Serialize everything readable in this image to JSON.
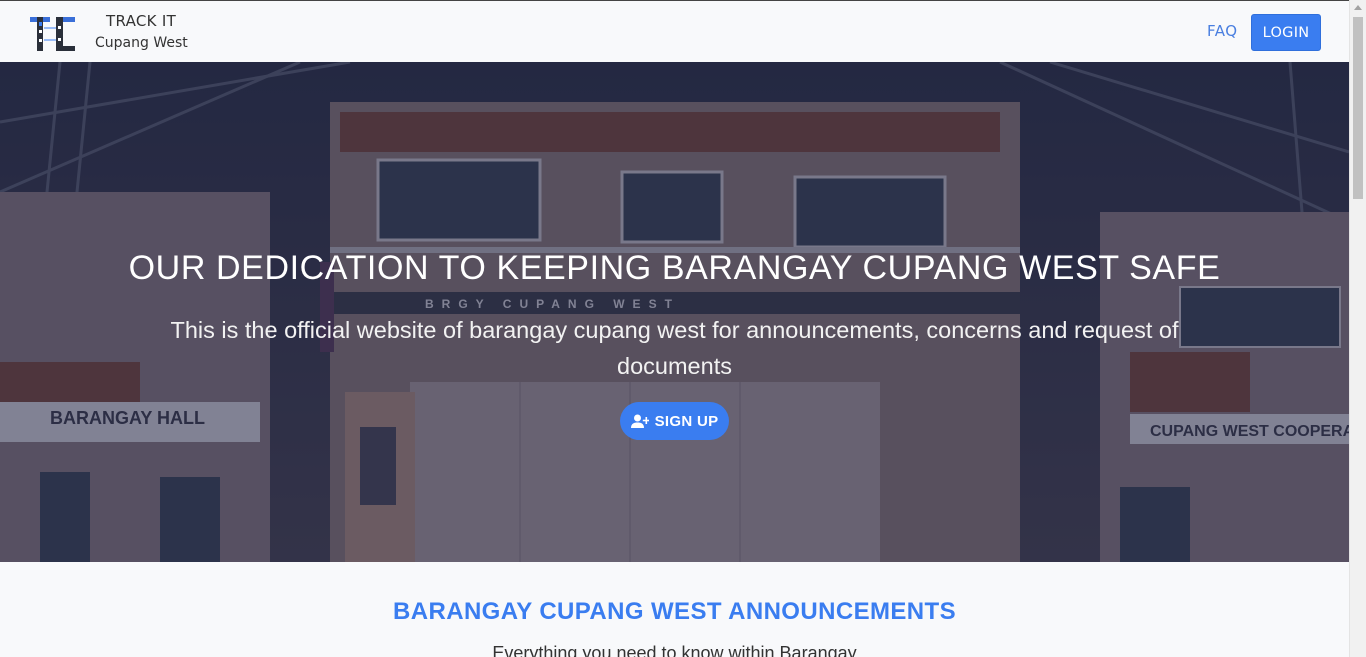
{
  "brand": {
    "title": "TRACK IT",
    "subtitle": "Cupang West",
    "logo_letters": "TI"
  },
  "nav": {
    "faq_label": "FAQ",
    "login_label": "LOGIN"
  },
  "hero": {
    "title": "OUR DEDICATION TO KEEPING BARANGAY CUPANG WEST SAFE",
    "description": "This is the official website of barangay cupang west for announcements, concerns and request of documents",
    "signup_label": "SIGN UP",
    "signup_icon": "user-plus-icon",
    "signs": {
      "hall": "BARANGAY HALL",
      "cooperative": "CUPANG WEST COOPERA",
      "building": "BRGY CUPANG WEST"
    }
  },
  "announcements": {
    "title": "BARANGAY CUPANG WEST ANNOUNCEMENTS",
    "subtitle": "Everything you need to know within Barangay"
  },
  "colors": {
    "accent": "#3a7df0",
    "navbar_bg": "#f8f9fb",
    "hero_overlay": "#191c3c"
  }
}
